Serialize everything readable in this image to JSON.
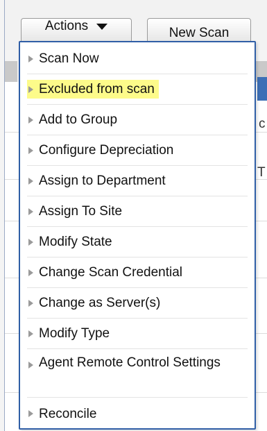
{
  "toolbar": {
    "actions_label": "Actions",
    "new_scan_label": "New Scan"
  },
  "background": {
    "peek_text_1": "c",
    "peek_text_2": "T"
  },
  "menu": {
    "items": [
      {
        "label": "Scan Now"
      },
      {
        "label": "Excluded from scan",
        "highlighted": true
      },
      {
        "label": "Add to Group"
      },
      {
        "label": "Configure Depreciation"
      },
      {
        "label": "Assign to Department"
      },
      {
        "label": "Assign To Site"
      },
      {
        "label": "Modify State"
      },
      {
        "label": "Change Scan Credential"
      },
      {
        "label": "Change as Server(s)"
      },
      {
        "label": "Modify Type"
      },
      {
        "label": "Agent Remote Control Settings"
      },
      {
        "label": "Reconcile"
      }
    ]
  },
  "colors": {
    "menu_border": "#2f5ea6",
    "highlight": "#fdfb8a",
    "selected_tab": "#3d6fb6"
  },
  "icons": [
    "caret-down-icon",
    "submenu-arrow-icon"
  ]
}
